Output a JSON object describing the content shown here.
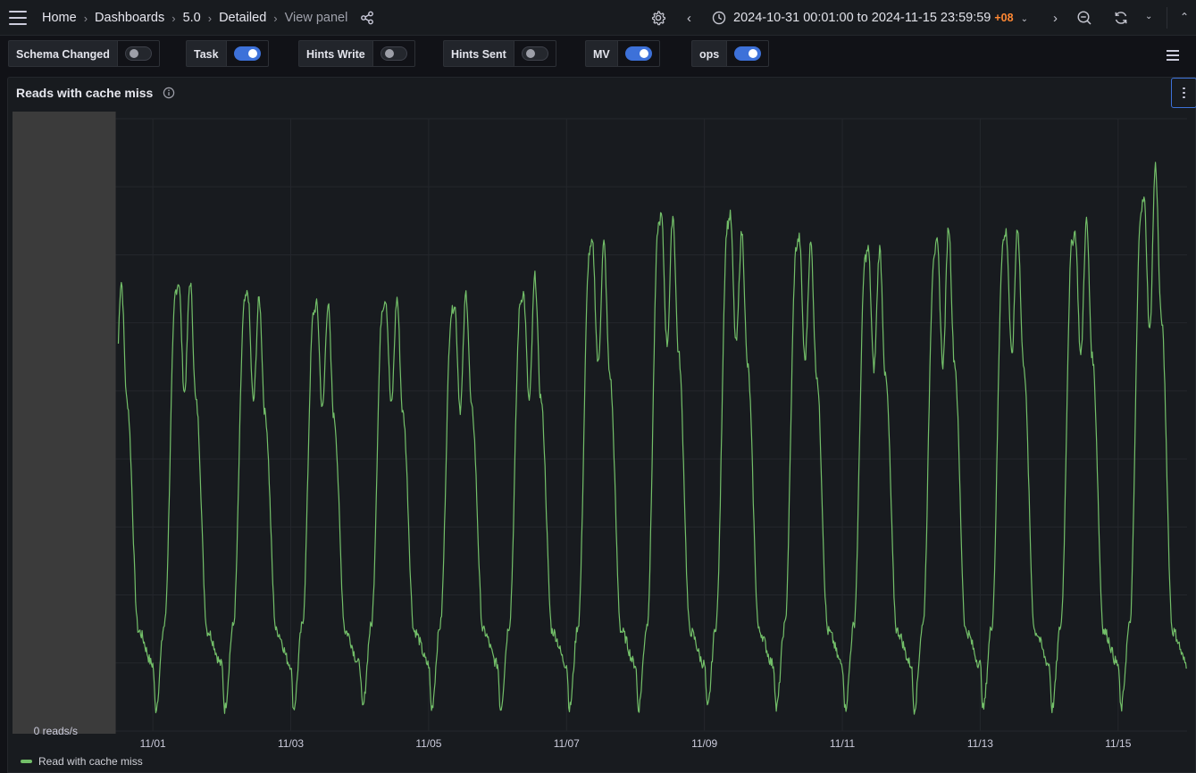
{
  "breadcrumb": {
    "items": [
      "Home",
      "Dashboards",
      "5.0",
      "Detailed",
      "View panel"
    ]
  },
  "time_picker": {
    "range": "2024-10-31 00:01:00 to 2024-11-15 23:59:59",
    "timezone": "+08"
  },
  "variables": [
    {
      "label": "Schema Changed",
      "on": false
    },
    {
      "label": "Task",
      "on": true
    },
    {
      "label": "Hints Write",
      "on": false
    },
    {
      "label": "Hints Sent",
      "on": false
    },
    {
      "label": "MV",
      "on": true
    },
    {
      "label": "ops",
      "on": true
    }
  ],
  "panel": {
    "title": "Reads with cache miss"
  },
  "colors": {
    "series": "#73bf69",
    "accent": "#3d71d9",
    "no_data_region": "#3b3b3b"
  },
  "icons": [
    "hamburger-icon",
    "share-icon",
    "gear-icon",
    "clock-icon",
    "chevron-left-icon",
    "chevron-right-icon",
    "zoom-out-icon",
    "refresh-icon",
    "chevron-down-icon",
    "chevron-up-icon",
    "menu-icon",
    "info-icon",
    "kebab-menu-icon"
  ],
  "chart_data": {
    "type": "line",
    "title": "Reads with cache miss",
    "y_tick_labels": [
      "0 reads/s"
    ],
    "x_tick_labels": [
      "11/01",
      "11/03",
      "11/05",
      "11/07",
      "11/09",
      "11/11",
      "11/13",
      "11/15"
    ],
    "x_range": [
      "2024-10-31 00:01:00",
      "2024-11-15 23:59:59"
    ],
    "no_data_until": "2024-10-31 12:00",
    "grid": true,
    "legend_placement": "bottom-left",
    "series": [
      {
        "name": "Read with cache miss",
        "color": "#73bf69",
        "daily_pattern": {
          "trough_hour": 1,
          "dip_hour": 10,
          "peaks_relative_to_max": [
            [
              0.74,
              0.77
            ],
            [
              0.77,
              0.77
            ],
            [
              0.75,
              0.74
            ],
            [
              0.73,
              0.73
            ],
            [
              0.74,
              0.74
            ],
            [
              0.73,
              0.75
            ],
            [
              0.75,
              0.78
            ],
            [
              0.84,
              0.84
            ],
            [
              0.89,
              0.89
            ],
            [
              0.89,
              0.86
            ],
            [
              0.85,
              0.84
            ],
            [
              0.83,
              0.83
            ],
            [
              0.84,
              0.87
            ],
            [
              0.86,
              0.87
            ],
            [
              0.86,
              0.88
            ],
            [
              0.92,
              0.98
            ]
          ]
        }
      }
    ]
  }
}
